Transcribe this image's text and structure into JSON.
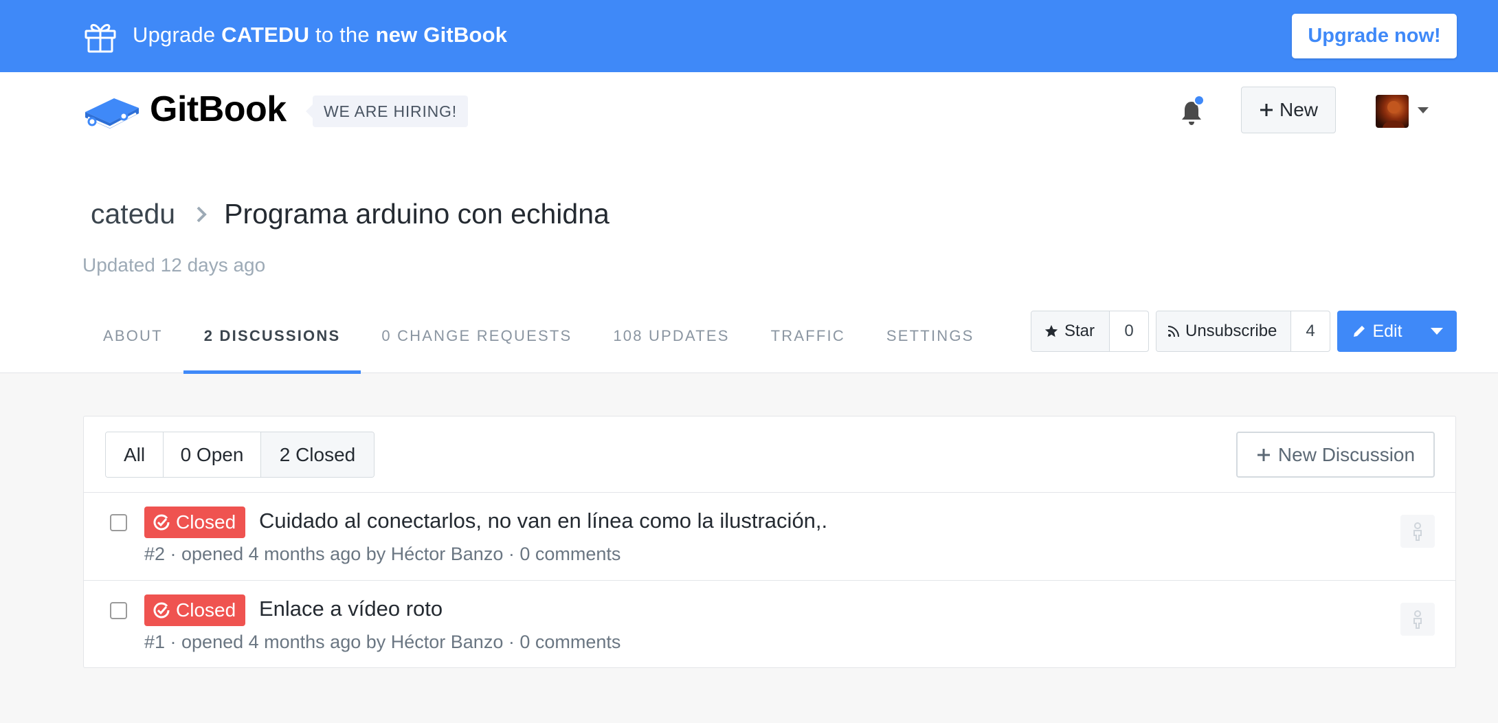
{
  "banner": {
    "text_prefix": "Upgrade ",
    "org": "CATEDU",
    "text_middle": " to the ",
    "product": "new GitBook",
    "button": "Upgrade now!",
    "bg_color": "#3f89f8"
  },
  "header": {
    "logo_text": "GitBook",
    "hiring": "WE ARE HIRING!",
    "new_button": "New",
    "notification_icon": "bell-icon",
    "has_notification": true
  },
  "book": {
    "parent": "catedu",
    "title": "Programa arduino con echidna",
    "updated": "Updated 12 days ago"
  },
  "tabs": [
    {
      "label": "ABOUT",
      "active": false
    },
    {
      "label": "2 DISCUSSIONS",
      "active": true
    },
    {
      "label": "0 CHANGE REQUESTS",
      "active": false
    },
    {
      "label": "108 UPDATES",
      "active": false
    },
    {
      "label": "TRAFFIC",
      "active": false
    },
    {
      "label": "SETTINGS",
      "active": false
    }
  ],
  "actions": {
    "star_label": "Star",
    "star_count": "0",
    "unsubscribe_label": "Unsubscribe",
    "subscriber_count": "4",
    "edit_label": "Edit"
  },
  "discussions": {
    "filters": {
      "all": "All",
      "open": "0 Open",
      "closed": "2 Closed"
    },
    "new_button": "New Discussion",
    "items": [
      {
        "status": "Closed",
        "title": "Cuidado al conectarlos, no van en línea como la ilustración,.",
        "meta": "#2 · opened 4 months ago by Héctor Banzo · 0 comments"
      },
      {
        "status": "Closed",
        "title": "Enlace a vídeo roto",
        "meta": "#1 · opened 4 months ago by Héctor Banzo · 0 comments"
      }
    ]
  },
  "colors": {
    "accent": "#3f89f8",
    "closed_badge": "#ef5350"
  }
}
